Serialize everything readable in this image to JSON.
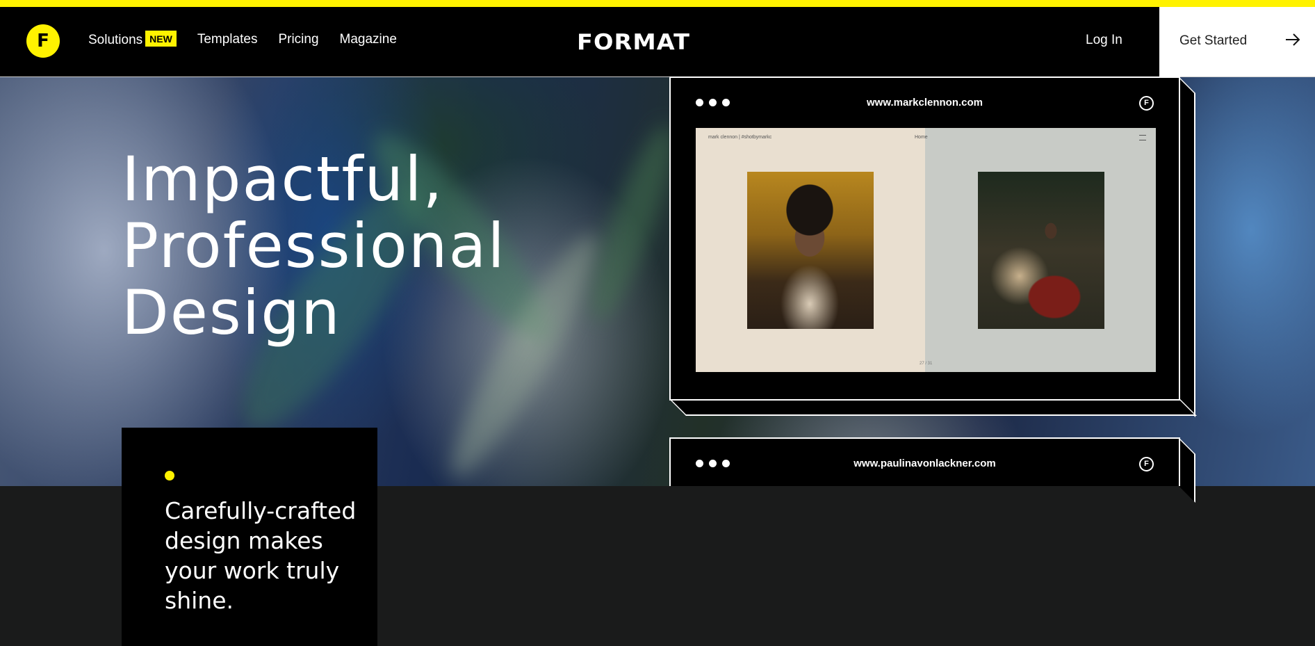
{
  "nav": {
    "logo_letter": "F",
    "links": [
      {
        "label": "Solutions",
        "badge": "NEW"
      },
      {
        "label": "Templates"
      },
      {
        "label": "Pricing"
      },
      {
        "label": "Magazine"
      }
    ],
    "brand": "FORMAT",
    "login_label": "Log In",
    "cta_label": "Get Started"
  },
  "hero": {
    "headline_lines": [
      "Impactful,",
      "Professional",
      "Design"
    ]
  },
  "browsers": [
    {
      "url": "www.markclennon.com",
      "icon_letter": "F",
      "site_meta": "mark clennon | #shotbymarkc",
      "site_nav": "Home",
      "page_indicator": "27 / 31"
    },
    {
      "url": "www.paulinavonlackner.com",
      "icon_letter": "F"
    }
  ],
  "card": {
    "text": "Carefully-crafted design makes your work truly shine."
  },
  "colors": {
    "accent": "#fff200",
    "background": "#1a1b1b"
  }
}
